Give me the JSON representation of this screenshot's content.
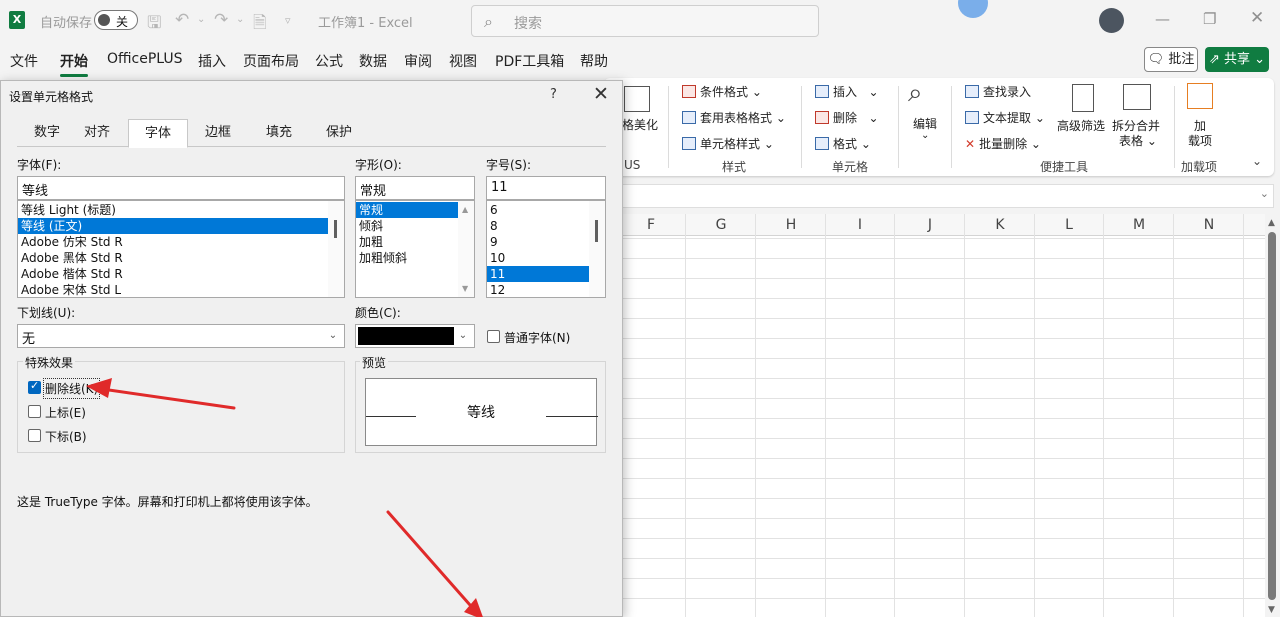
{
  "titlebar": {
    "logo": "X",
    "autosave_label": "自动保存",
    "autosave_state": "关",
    "doc_title": "工作簿1 - Excel",
    "search_placeholder": "搜索"
  },
  "menu": {
    "items": [
      "文件",
      "开始",
      "OfficePLUS",
      "插入",
      "页面布局",
      "公式",
      "数据",
      "审阅",
      "视图",
      "PDF工具箱",
      "帮助"
    ],
    "active": "开始",
    "comment_label": "批注",
    "share_label": "共享"
  },
  "ribbon": {
    "partial_beautify": "格美化",
    "partial_group": "US",
    "styles": {
      "cond_format": "条件格式",
      "table_format": "套用表格格式",
      "cell_style": "单元格样式",
      "group": "样式"
    },
    "cells": {
      "insert": "插入",
      "delete": "删除",
      "format": "格式",
      "group": "单元格"
    },
    "edit": {
      "label": "编辑"
    },
    "quick": {
      "find_record": "查找录入",
      "text_extract": "文本提取",
      "batch_delete": "批量删除",
      "adv_filter": "高级筛选",
      "split_merge_1": "拆分合并",
      "split_merge_2": "表格",
      "group": "便捷工具"
    },
    "addins": {
      "label_1": "加",
      "label_2": "载项",
      "group": "加载项"
    }
  },
  "grid": {
    "columns": [
      "F",
      "G",
      "H",
      "I",
      "J",
      "K",
      "L",
      "M",
      "N"
    ]
  },
  "dialog": {
    "title": "设置单元格格式",
    "help": "?",
    "tabs": [
      "数字",
      "对齐",
      "字体",
      "边框",
      "填充",
      "保护"
    ],
    "active_tab": "字体",
    "font": {
      "label": "字体(F):",
      "value": "等线",
      "list": [
        "等线 Light (标题)",
        "等线 (正文)",
        "Adobe 仿宋 Std R",
        "Adobe 黑体 Std R",
        "Adobe 楷体 Std R",
        "Adobe 宋体 Std L"
      ],
      "selected": "等线 (正文)"
    },
    "style": {
      "label": "字形(O):",
      "value": "常规",
      "list": [
        "常规",
        "倾斜",
        "加粗",
        "加粗倾斜"
      ],
      "selected": "常规"
    },
    "size": {
      "label": "字号(S):",
      "value": "11",
      "list": [
        "6",
        "8",
        "9",
        "10",
        "11",
        "12"
      ],
      "selected": "11"
    },
    "underline": {
      "label": "下划线(U):",
      "value": "无"
    },
    "color": {
      "label": "颜色(C):",
      "value_color": "#000000"
    },
    "normal_font": {
      "label": "普通字体(N)",
      "checked": false
    },
    "effects": {
      "label": "特殊效果",
      "strike": {
        "label": "删除线(K)",
        "checked": true
      },
      "superscript": {
        "label": "上标(E)",
        "checked": false
      },
      "subscript": {
        "label": "下标(B)",
        "checked": false
      }
    },
    "preview": {
      "label": "预览",
      "sample": "等线"
    },
    "description": "这是 TrueType 字体。屏幕和打印机上都将使用该字体。"
  },
  "colors": {
    "excel_green": "#107c41",
    "selection_blue": "#0078d7",
    "annotation_red": "#e02a2a"
  }
}
